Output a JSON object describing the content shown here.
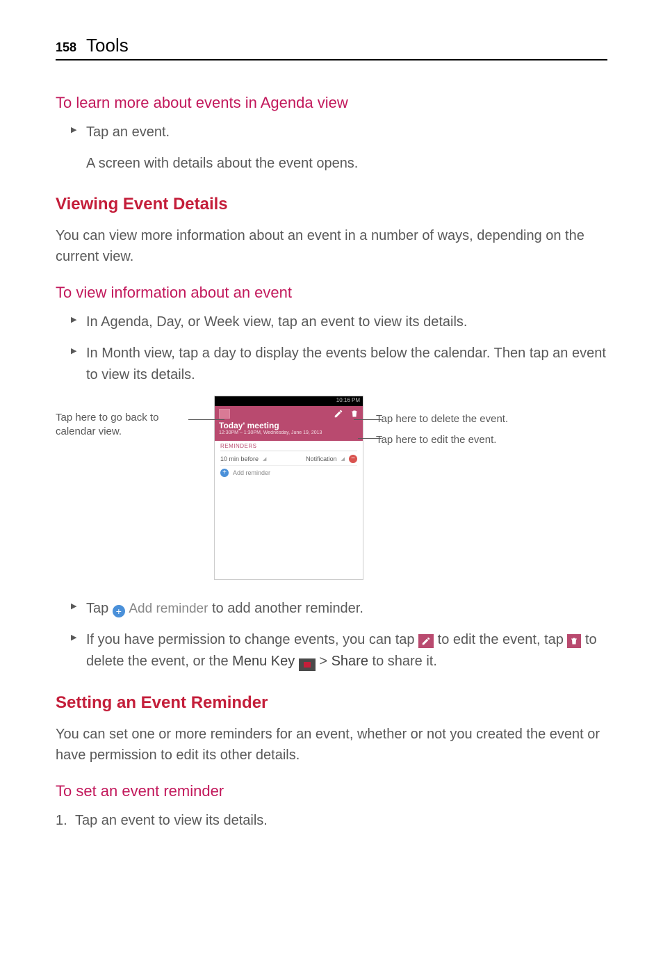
{
  "header": {
    "page_number": "158",
    "title": "Tools"
  },
  "sec1": {
    "title": "To learn more about events in Agenda view",
    "bullet1": "Tap an event.",
    "sub1": "A screen with details about the event opens."
  },
  "sec2": {
    "title": "Viewing Event Details",
    "body": "You can view more information about an event in a number of ways, depending on the current view."
  },
  "sec3": {
    "title": "To view information about an event",
    "bullet1": "In Agenda, Day, or Week view, tap an event to view its details.",
    "bullet2": "In Month view, tap a day to display the events below the calendar. Then tap an event to view its details.",
    "bullet3_a": "Tap ",
    "bullet3_label": "Add reminder",
    "bullet3_b": " to add another reminder.",
    "bullet4_a": "If you have permission to change events, you can tap ",
    "bullet4_b": " to edit the event, tap ",
    "bullet4_c": " to delete the event, or the ",
    "bullet4_menu": "Menu Key",
    "bullet4_d": " > ",
    "bullet4_share": "Share",
    "bullet4_e": " to share it."
  },
  "callouts": {
    "left": "Tap here to go back to calendar view.",
    "right_delete": "Tap here to delete the event.",
    "right_edit": "Tap here to edit the event."
  },
  "phone": {
    "status_time": "10:16 PM",
    "event_title": "Today' meeting",
    "event_time": "12:30PM – 1:30PM, Wednesday, June 19, 2013",
    "reminders_label": "REMINDERS",
    "rem_time": "10 min before",
    "rem_type": "Notification",
    "add_reminder": "Add reminder"
  },
  "sec4": {
    "title": "Setting an Event Reminder",
    "body": "You can set one or more reminders for an event, whether or not you created the event or have permission to edit its other details."
  },
  "sec5": {
    "title": "To set an event reminder",
    "step1": "Tap an event to view its details."
  }
}
